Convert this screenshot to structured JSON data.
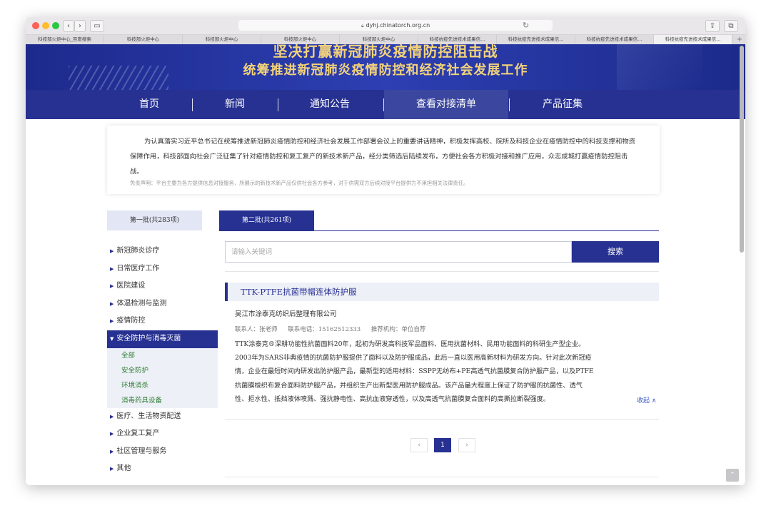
{
  "browser": {
    "url": "dyhj.chinatorch.org.cn",
    "tabs": [
      "科技部火炬中心_百度搜索",
      "科技部火炬中心",
      "科技部火炬中心",
      "科技部火炬中心",
      "科技部火炬中心",
      "科技抗疫先进技术成果信...",
      "科技抗疫先进技术成果信...",
      "科技抗疫先进技术成果信...",
      "科技抗疫先进技术成果信..."
    ],
    "active_tab_index": 8
  },
  "banner": {
    "line1": "坚决打赢新冠肺炎疫情防控阻击战",
    "line2": "统筹推进新冠肺炎疫情防控和经济社会发展工作"
  },
  "nav": {
    "items": [
      "首页",
      "新闻",
      "通知公告",
      "查看对接清单",
      "产品征集"
    ],
    "active": "查看对接清单"
  },
  "intro": {
    "text": "为认真落实习近平总书记在统筹推进新冠肺炎疫情防控和经济社会发展工作部署会议上的重要讲话精神，积极发挥高校、院所及科技企业在疫情防控中的科技支撑和物资保障作用，科技部面向社会广泛征集了针对疫情防控和复工复产的新技术新产品，经分类筛选后陆续发布，方便社会各方积极对接和推广应用，众志成城打赢疫情防控阻击战。",
    "disclaimer": "免责声明：平台主要为各方提供信息对接服务，所展示的新技术新产品仅供社会各方参考，对于供需双方后续对接平台提供方不承担相关法律责任。"
  },
  "batches": {
    "first": "第一批(共283项)",
    "second": "第二批(共261项)"
  },
  "sidebar": {
    "categories": [
      "新冠肺炎诊疗",
      "日常医疗工作",
      "医院建设",
      "体温检测与监测",
      "疫情防控",
      "安全防护与消毒灭菌",
      "医疗、生活物资配送",
      "企业复工复产",
      "社区管理与服务",
      "其他"
    ],
    "active_index": 5,
    "subitems": [
      "全部",
      "安全防护",
      "环境消杀",
      "消毒药具设备"
    ]
  },
  "search": {
    "placeholder": "请输入关键词",
    "button": "搜索"
  },
  "product": {
    "title": "TTK-PTFE抗菌带帽连体防护服",
    "company": "吴江市涂泰克纺织后整理有限公司",
    "contact": "联系人：张老师",
    "phone": "联系电话：15162512333",
    "org": "推荐机构：单位自荐",
    "desc_lines": [
      "TTK涂泰克®深耕功能性抗菌面料20年，起初为研发高科技军品面料、医用抗菌材料、民用功能面料的科研生产型企业。",
      "2003年为SARS非典疫情的抗菌防护服提供了面料以及防护服成品，此后一直以医用高新材料为研发方向。针对此次新冠疫",
      "情，企业在最短时间内研发出防护服产品，最新型的适用材料：SSPP无纺布+PE高透气抗菌膜复合防护服产品，以及PTFE",
      "抗菌膜梭织布复合面料防护服产品，并组织生产出新型医用防护服成品。该产品最大程度上保证了防护服的抗菌性、透气",
      "性、拒水性、抵挡液体喷溅、强抗静电性、高抗血液穿透性，以及高透气抗菌膜复合面料的高撕拉断裂强度。"
    ],
    "collapse": "收起 ∧"
  },
  "pagination": {
    "prev": "‹",
    "current": "1",
    "next": "›"
  }
}
